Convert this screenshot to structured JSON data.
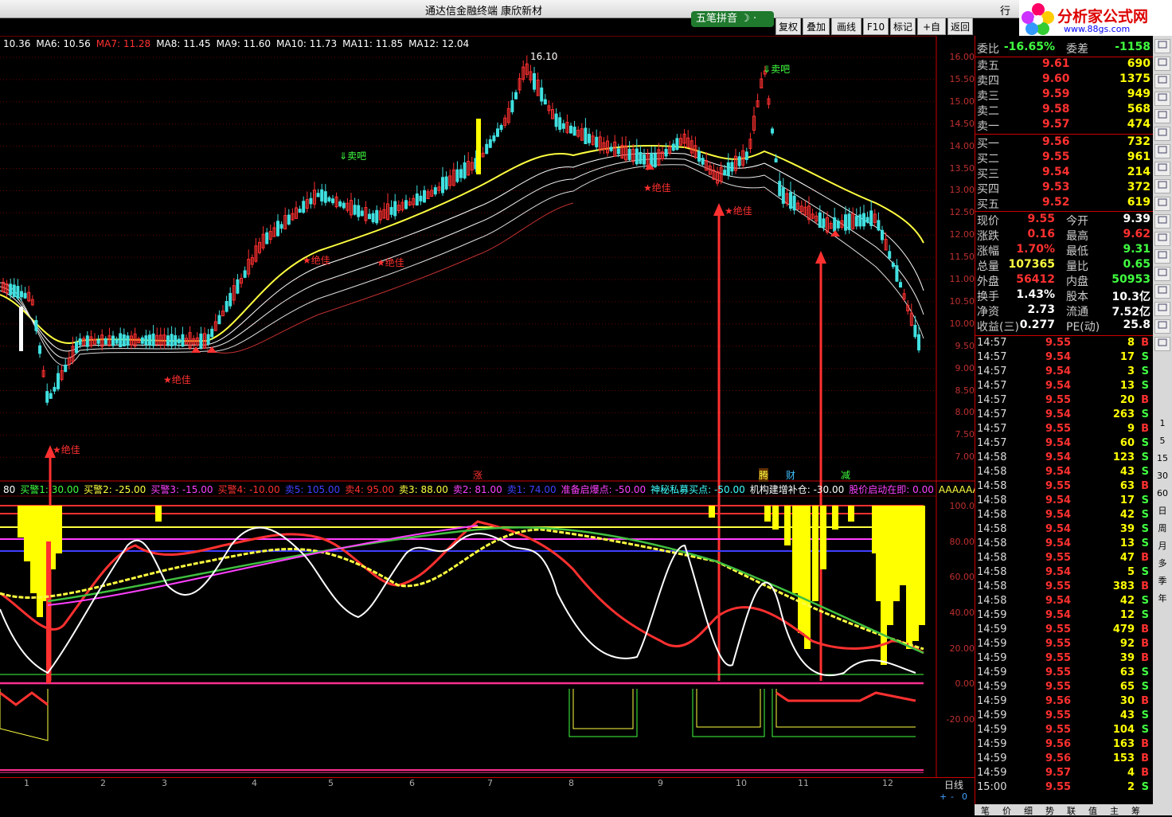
{
  "window": {
    "title": "通达信金融终端    康欣新材"
  },
  "ime": {
    "label": "五笔拼音"
  },
  "toolbar": [
    "复权",
    "叠加",
    "画线",
    "F10",
    "标记",
    "+自选",
    "返回"
  ],
  "top_right_tab": "行",
  "logo": {
    "main": "分析家公式网",
    "url": "www.88gs.com"
  },
  "ma_bar": [
    {
      "text": "10.36",
      "color": "#ffffff"
    },
    {
      "text": "MA6: 10.56",
      "color": "#ffffff"
    },
    {
      "text": "MA7: 11.28",
      "color": "#ff3030"
    },
    {
      "text": "MA8: 11.45",
      "color": "#ffffff"
    },
    {
      "text": "MA9: 11.60",
      "color": "#ffffff"
    },
    {
      "text": "MA10: 11.73",
      "color": "#ffffff"
    },
    {
      "text": "MA11: 11.85",
      "color": "#ffffff"
    },
    {
      "text": "MA12: 12.04",
      "color": "#ffffff"
    }
  ],
  "indicator_bar": [
    {
      "text": "80",
      "color": "#ffffff"
    },
    {
      "text": "买警1: 30.00",
      "color": "#40ff40"
    },
    {
      "text": "买警2: -25.00",
      "color": "#ffff40"
    },
    {
      "text": "买警3: -15.00",
      "color": "#ff40ff"
    },
    {
      "text": "买警4: -10.00",
      "color": "#ff3030"
    },
    {
      "text": "卖5: 105.00",
      "color": "#4040ff"
    },
    {
      "text": "卖4: 95.00",
      "color": "#ff3030"
    },
    {
      "text": "卖3: 88.00",
      "color": "#ffff40"
    },
    {
      "text": "卖2: 81.00",
      "color": "#ff40ff"
    },
    {
      "text": "卖1: 74.00",
      "color": "#4040ff"
    },
    {
      "text": "准备启爆点: -50.00",
      "color": "#ff40ff"
    },
    {
      "text": "神秘私募买点: -50.00",
      "color": "#40ffff"
    },
    {
      "text": "机构建增补仓: -30.00",
      "color": "#ffffff"
    },
    {
      "text": "股价启动在即: 0.00",
      "color": "#ff40ff"
    },
    {
      "text": "AAAAAA",
      "color": "#ffff40"
    }
  ],
  "price_axis": [
    "16.00",
    "15.50",
    "15.00",
    "14.50",
    "14.00",
    "13.50",
    "13.00",
    "12.50",
    "12.00",
    "11.50",
    "11.00",
    "10.50",
    "10.00",
    "9.50",
    "9.00",
    "8.50",
    "8.00",
    "7.50",
    "7.00"
  ],
  "indicator_axis": [
    "100.0",
    "80.00",
    "60.00",
    "40.00",
    "20.00",
    "0.00",
    "-20.00"
  ],
  "annotations": {
    "high": "16.10",
    "sell1": "卖吧",
    "sell2": "卖吧",
    "jue": "绝佳",
    "zhang": "涨",
    "teng": "腾",
    "cai": "财",
    "jian": "减"
  },
  "months": [
    "1",
    "2",
    "3",
    "4",
    "5",
    "6",
    "7",
    "8",
    "9",
    "10",
    "11",
    "12"
  ],
  "period": "日线",
  "quotes": {
    "weibi": {
      "label": "委比",
      "value": "-16.65%",
      "label2": "委差",
      "value2": "-1158"
    },
    "sell": [
      {
        "label": "卖五",
        "price": "9.61",
        "vol": "690"
      },
      {
        "label": "卖四",
        "price": "9.60",
        "vol": "1375"
      },
      {
        "label": "卖三",
        "price": "9.59",
        "vol": "949"
      },
      {
        "label": "卖二",
        "price": "9.58",
        "vol": "568"
      },
      {
        "label": "卖一",
        "price": "9.57",
        "vol": "474"
      }
    ],
    "buy": [
      {
        "label": "买一",
        "price": "9.56",
        "vol": "732"
      },
      {
        "label": "买二",
        "price": "9.55",
        "vol": "961"
      },
      {
        "label": "买三",
        "price": "9.54",
        "vol": "214"
      },
      {
        "label": "买四",
        "price": "9.53",
        "vol": "372"
      },
      {
        "label": "买五",
        "price": "9.52",
        "vol": "619"
      }
    ],
    "stats": [
      {
        "l1": "现价",
        "v1": "9.55",
        "c1": "#ff3030",
        "l2": "今开",
        "v2": "9.39",
        "c2": "#ffffff"
      },
      {
        "l1": "涨跌",
        "v1": "0.16",
        "c1": "#ff3030",
        "l2": "最高",
        "v2": "9.62",
        "c2": "#ff3030"
      },
      {
        "l1": "涨幅",
        "v1": "1.70%",
        "c1": "#ff3030",
        "l2": "最低",
        "v2": "9.31",
        "c2": "#40ff40"
      },
      {
        "l1": "总量",
        "v1": "107365",
        "c1": "#ffff40",
        "l2": "量比",
        "v2": "0.65",
        "c2": "#40ff40"
      },
      {
        "l1": "外盘",
        "v1": "56412",
        "c1": "#ff3030",
        "l2": "内盘",
        "v2": "50953",
        "c2": "#40ff40"
      },
      {
        "l1": "换手",
        "v1": "1.43%",
        "c1": "#ffffff",
        "l2": "股本",
        "v2": "10.3亿",
        "c2": "#ffffff"
      },
      {
        "l1": "净资",
        "v1": "2.73",
        "c1": "#ffffff",
        "l2": "流通",
        "v2": "7.52亿",
        "c2": "#ffffff"
      },
      {
        "l1": "收益(三)",
        "v1": "0.277",
        "c1": "#ffffff",
        "l2": "PE(动)",
        "v2": "25.8",
        "c2": "#ffffff"
      }
    ]
  },
  "ticks": [
    {
      "t": "14:57",
      "p": "9.55",
      "pc": "#ff3030",
      "v": "8",
      "f": "B"
    },
    {
      "t": "14:57",
      "p": "9.54",
      "pc": "#ff3030",
      "v": "17",
      "f": "S"
    },
    {
      "t": "14:57",
      "p": "9.54",
      "pc": "#ff3030",
      "v": "3",
      "f": "S"
    },
    {
      "t": "14:57",
      "p": "9.54",
      "pc": "#ff3030",
      "v": "13",
      "f": "S"
    },
    {
      "t": "14:57",
      "p": "9.55",
      "pc": "#ff3030",
      "v": "20",
      "f": "B"
    },
    {
      "t": "14:57",
      "p": "9.54",
      "pc": "#ff3030",
      "v": "263",
      "f": "S"
    },
    {
      "t": "14:57",
      "p": "9.55",
      "pc": "#ff3030",
      "v": "9",
      "f": "B"
    },
    {
      "t": "14:57",
      "p": "9.54",
      "pc": "#ff3030",
      "v": "60",
      "f": "S"
    },
    {
      "t": "14:58",
      "p": "9.54",
      "pc": "#ff3030",
      "v": "123",
      "f": "S"
    },
    {
      "t": "14:58",
      "p": "9.54",
      "pc": "#ff3030",
      "v": "43",
      "f": "S"
    },
    {
      "t": "14:58",
      "p": "9.55",
      "pc": "#ff3030",
      "v": "63",
      "f": "B"
    },
    {
      "t": "14:58",
      "p": "9.54",
      "pc": "#ff3030",
      "v": "17",
      "f": "S"
    },
    {
      "t": "14:58",
      "p": "9.54",
      "pc": "#ff3030",
      "v": "42",
      "f": "S"
    },
    {
      "t": "14:58",
      "p": "9.54",
      "pc": "#ff3030",
      "v": "39",
      "f": "S"
    },
    {
      "t": "14:58",
      "p": "9.54",
      "pc": "#ff3030",
      "v": "13",
      "f": "S"
    },
    {
      "t": "14:58",
      "p": "9.55",
      "pc": "#ff3030",
      "v": "47",
      "f": "B"
    },
    {
      "t": "14:58",
      "p": "9.54",
      "pc": "#ff3030",
      "v": "5",
      "f": "S"
    },
    {
      "t": "14:58",
      "p": "9.55",
      "pc": "#ff3030",
      "v": "383",
      "f": "B"
    },
    {
      "t": "14:58",
      "p": "9.54",
      "pc": "#ff3030",
      "v": "42",
      "f": "S"
    },
    {
      "t": "14:59",
      "p": "9.54",
      "pc": "#ff3030",
      "v": "12",
      "f": "S"
    },
    {
      "t": "14:59",
      "p": "9.55",
      "pc": "#ff3030",
      "v": "479",
      "f": "B"
    },
    {
      "t": "14:59",
      "p": "9.55",
      "pc": "#ff3030",
      "v": "92",
      "f": "B"
    },
    {
      "t": "14:59",
      "p": "9.55",
      "pc": "#ff3030",
      "v": "39",
      "f": "B"
    },
    {
      "t": "14:59",
      "p": "9.55",
      "pc": "#ff3030",
      "v": "63",
      "f": "S"
    },
    {
      "t": "14:59",
      "p": "9.55",
      "pc": "#ff3030",
      "v": "65",
      "f": "S"
    },
    {
      "t": "14:59",
      "p": "9.56",
      "pc": "#ff3030",
      "v": "30",
      "f": "B"
    },
    {
      "t": "14:59",
      "p": "9.55",
      "pc": "#ff3030",
      "v": "43",
      "f": "S"
    },
    {
      "t": "14:59",
      "p": "9.55",
      "pc": "#ff3030",
      "v": "104",
      "f": "S"
    },
    {
      "t": "14:59",
      "p": "9.56",
      "pc": "#ff3030",
      "v": "163",
      "f": "B"
    },
    {
      "t": "14:59",
      "p": "9.56",
      "pc": "#ff3030",
      "v": "153",
      "f": "B"
    },
    {
      "t": "14:59",
      "p": "9.57",
      "pc": "#ff3030",
      "v": "4",
      "f": "B"
    },
    {
      "t": "15:00",
      "p": "9.55",
      "pc": "#ff3030",
      "v": "2",
      "f": "S"
    }
  ],
  "sidebar": [
    "1",
    "5",
    "15",
    "30",
    "60",
    "日",
    "周",
    "月",
    "多",
    "季",
    "年"
  ],
  "bottom_tabs": [
    "笔",
    "价",
    "细",
    "势",
    "联",
    "值",
    "主",
    "筹"
  ],
  "scale_controls": [
    "+",
    "-",
    "0"
  ]
}
